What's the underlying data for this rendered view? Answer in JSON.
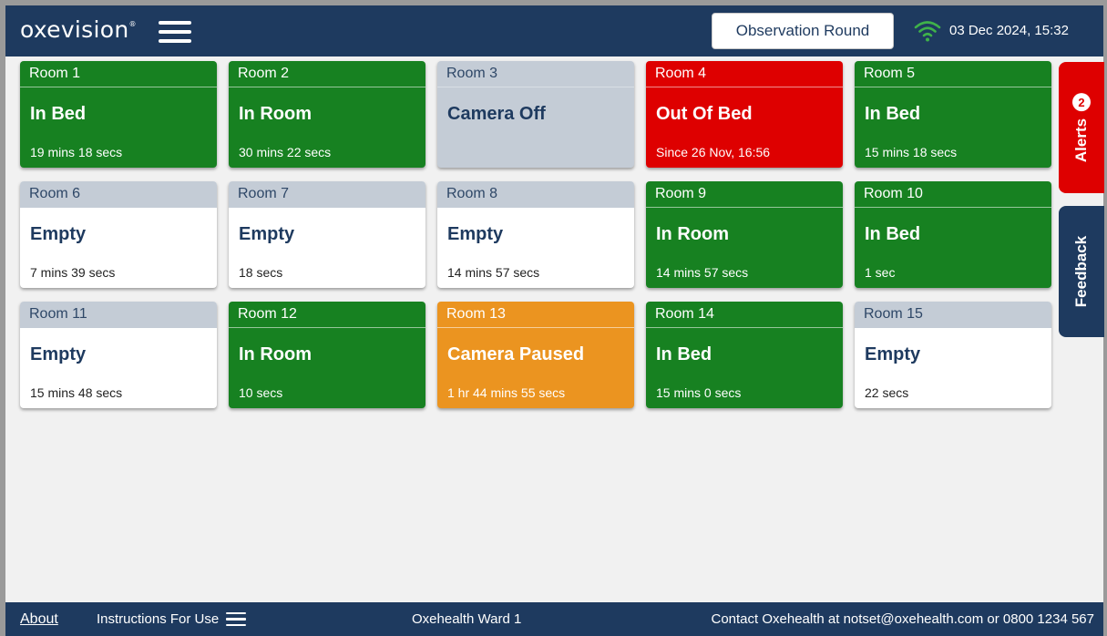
{
  "header": {
    "logo": "oxevision",
    "logo_mark": "®",
    "menu_icon": "hamburger-menu-icon",
    "observation_button": "Observation Round",
    "wifi_icon": "wifi-icon",
    "wifi_color": "#3fb24a",
    "datetime": "03 Dec 2024, 15:32"
  },
  "rooms": [
    {
      "name": "Room 1",
      "status": "In Bed",
      "time": "19 mins 18 secs",
      "state": "green"
    },
    {
      "name": "Room 2",
      "status": "In Room",
      "time": "30 mins 22 secs",
      "state": "green"
    },
    {
      "name": "Room 3",
      "status": "Camera Off",
      "time": "",
      "state": "grey"
    },
    {
      "name": "Room 4",
      "status": "Out Of Bed",
      "time": "Since 26 Nov, 16:56",
      "state": "red"
    },
    {
      "name": "Room 5",
      "status": "In Bed",
      "time": "15 mins 18 secs",
      "state": "green"
    },
    {
      "name": "Room 6",
      "status": "Empty",
      "time": "7 mins 39 secs",
      "state": "white"
    },
    {
      "name": "Room 7",
      "status": "Empty",
      "time": "18 secs",
      "state": "white"
    },
    {
      "name": "Room 8",
      "status": "Empty",
      "time": "14 mins 57 secs",
      "state": "white"
    },
    {
      "name": "Room 9",
      "status": "In Room",
      "time": "14 mins 57 secs",
      "state": "green"
    },
    {
      "name": "Room 10",
      "status": "In Bed",
      "time": "1 sec",
      "state": "green"
    },
    {
      "name": "Room 11",
      "status": "Empty",
      "time": "15 mins 48 secs",
      "state": "white"
    },
    {
      "name": "Room 12",
      "status": "In Room",
      "time": "10 secs",
      "state": "green"
    },
    {
      "name": "Room 13",
      "status": "Camera Paused",
      "time": "1 hr 44 mins 55 secs",
      "state": "orange"
    },
    {
      "name": "Room 14",
      "status": "In Bed",
      "time": "15 mins 0 secs",
      "state": "green"
    },
    {
      "name": "Room 15",
      "status": "Empty",
      "time": "22 secs",
      "state": "white"
    }
  ],
  "side": {
    "alerts_label": "Alerts",
    "alerts_count": "2",
    "feedback_label": "Feedback"
  },
  "footer": {
    "about": "About",
    "instructions": "Instructions For Use",
    "ward": "Oxehealth Ward 1",
    "contact": "Contact Oxehealth at notset@oxehealth.com or 0800 1234 567"
  },
  "colors": {
    "navy": "#1e3a5f",
    "green": "#178121",
    "red": "#de0000",
    "orange": "#eb9420",
    "grey": "#c4ccd6"
  }
}
